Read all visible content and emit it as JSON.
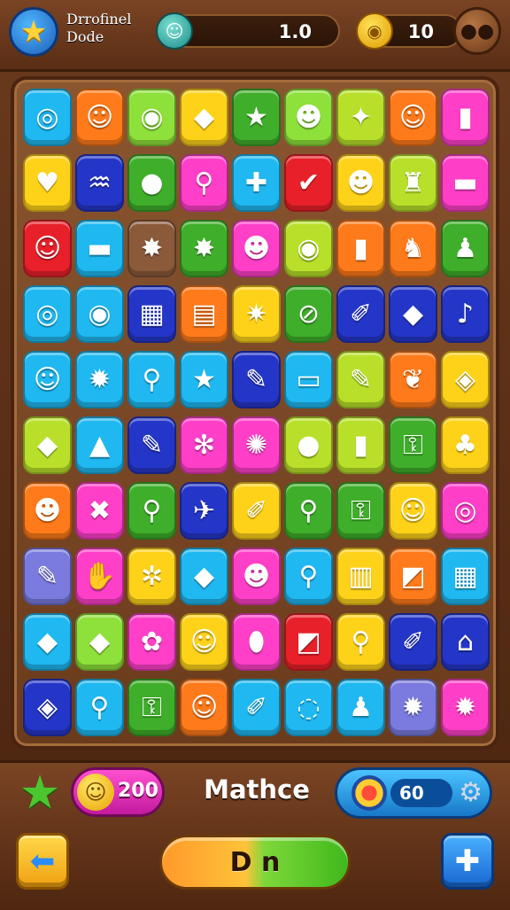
{
  "header": {
    "title": "Drrofinel\nDode",
    "level_value": "1.0",
    "coins_value": "10",
    "menu_glyph": "●●",
    "star_icon": "star-icon",
    "level_icon": "avatar-icon",
    "coin_icon": "coin-icon"
  },
  "board": {
    "rows": [
      [
        {
          "c": "#1fb8f0",
          "g": "◎"
        },
        {
          "c": "#ff7a1a",
          "g": "☺"
        },
        {
          "c": "#8ee03a",
          "g": "◉"
        },
        {
          "c": "#ffd21a",
          "g": "◆"
        },
        {
          "c": "#3fae2a",
          "g": "★"
        },
        {
          "c": "#8ee03a",
          "g": "☻"
        },
        {
          "c": "#b8e02a",
          "g": "✦"
        },
        {
          "c": "#ff7a1a",
          "g": "☺"
        },
        {
          "c": "#ff3fc8",
          "g": "▮"
        }
      ],
      [
        {
          "c": "#ffd21a",
          "g": "♥"
        },
        {
          "c": "#2436c8",
          "g": "♒"
        },
        {
          "c": "#3fae2a",
          "g": "●"
        },
        {
          "c": "#ff3fc8",
          "g": "⚲"
        },
        {
          "c": "#1fb8f0",
          "g": "✚"
        },
        {
          "c": "#e8202a",
          "g": "✔"
        },
        {
          "c": "#ffd21a",
          "g": "☻"
        },
        {
          "c": "#b8e02a",
          "g": "♜"
        },
        {
          "c": "#ff3fc8",
          "g": "▬"
        }
      ],
      [
        {
          "c": "#e8202a",
          "g": "☺"
        },
        {
          "c": "#1fb8f0",
          "g": "▬"
        },
        {
          "c": "#8a5a3a",
          "g": "✸"
        },
        {
          "c": "#3fae2a",
          "g": "✸"
        },
        {
          "c": "#ff3fc8",
          "g": "☻"
        },
        {
          "c": "#b8e02a",
          "g": "◉"
        },
        {
          "c": "#ff7a1a",
          "g": "▮"
        },
        {
          "c": "#ff7a1a",
          "g": "♞"
        },
        {
          "c": "#3fae2a",
          "g": "♟"
        }
      ],
      [
        {
          "c": "#1fb8f0",
          "g": "◎"
        },
        {
          "c": "#1fb8f0",
          "g": "◉"
        },
        {
          "c": "#2436c8",
          "g": "▦"
        },
        {
          "c": "#ff7a1a",
          "g": "▤"
        },
        {
          "c": "#ffd21a",
          "g": "✷"
        },
        {
          "c": "#3fae2a",
          "g": "⊘"
        },
        {
          "c": "#2436c8",
          "g": "✐"
        },
        {
          "c": "#2436c8",
          "g": "◆"
        },
        {
          "c": "#2436c8",
          "g": "♪"
        }
      ],
      [
        {
          "c": "#1fb8f0",
          "g": "☺"
        },
        {
          "c": "#1fb8f0",
          "g": "✹"
        },
        {
          "c": "#1fb8f0",
          "g": "⚲"
        },
        {
          "c": "#1fb8f0",
          "g": "★"
        },
        {
          "c": "#2436c8",
          "g": "✎"
        },
        {
          "c": "#1fb8f0",
          "g": "▭"
        },
        {
          "c": "#b8e02a",
          "g": "✎"
        },
        {
          "c": "#ff7a1a",
          "g": "❦"
        },
        {
          "c": "#ffd21a",
          "g": "◈"
        }
      ],
      [
        {
          "c": "#b8e02a",
          "g": "◆"
        },
        {
          "c": "#1fb8f0",
          "g": "▲"
        },
        {
          "c": "#2436c8",
          "g": "✎"
        },
        {
          "c": "#ff3fc8",
          "g": "✻"
        },
        {
          "c": "#ff3fc8",
          "g": "✺"
        },
        {
          "c": "#b8e02a",
          "g": "●"
        },
        {
          "c": "#b8e02a",
          "g": "▮"
        },
        {
          "c": "#3fae2a",
          "g": "⚿"
        },
        {
          "c": "#ffd21a",
          "g": "♣"
        }
      ],
      [
        {
          "c": "#ff7a1a",
          "g": "☻"
        },
        {
          "c": "#ff3fc8",
          "g": "✖"
        },
        {
          "c": "#3fae2a",
          "g": "⚲"
        },
        {
          "c": "#2436c8",
          "g": "✈"
        },
        {
          "c": "#ffd21a",
          "g": "✐"
        },
        {
          "c": "#3fae2a",
          "g": "⚲"
        },
        {
          "c": "#3fae2a",
          "g": "⚿"
        },
        {
          "c": "#ffd21a",
          "g": "☺"
        },
        {
          "c": "#ff3fc8",
          "g": "◎"
        }
      ],
      [
        {
          "c": "#7a7adf",
          "g": "✎"
        },
        {
          "c": "#ff3fc8",
          "g": "✋"
        },
        {
          "c": "#ffd21a",
          "g": "✲"
        },
        {
          "c": "#1fb8f0",
          "g": "◆"
        },
        {
          "c": "#ff3fc8",
          "g": "☻"
        },
        {
          "c": "#1fb8f0",
          "g": "⚲"
        },
        {
          "c": "#ffd21a",
          "g": "▥"
        },
        {
          "c": "#ff7a1a",
          "g": "◩"
        },
        {
          "c": "#1fb8f0",
          "g": "▦"
        }
      ],
      [
        {
          "c": "#1fb8f0",
          "g": "◆"
        },
        {
          "c": "#8ee03a",
          "g": "◆"
        },
        {
          "c": "#ff3fc8",
          "g": "✿"
        },
        {
          "c": "#ffd21a",
          "g": "☺"
        },
        {
          "c": "#ff3fc8",
          "g": "⬮"
        },
        {
          "c": "#e8202a",
          "g": "◩"
        },
        {
          "c": "#ffd21a",
          "g": "⚲"
        },
        {
          "c": "#2436c8",
          "g": "✐"
        },
        {
          "c": "#2436c8",
          "g": "⌂"
        }
      ],
      [
        {
          "c": "#2436c8",
          "g": "◈"
        },
        {
          "c": "#1fb8f0",
          "g": "⚲"
        },
        {
          "c": "#3fae2a",
          "g": "⚿"
        },
        {
          "c": "#ff7a1a",
          "g": "☺"
        },
        {
          "c": "#1fb8f0",
          "g": "✐"
        },
        {
          "c": "#1fb8f0",
          "g": "◌"
        },
        {
          "c": "#1fb8f0",
          "g": "♟"
        },
        {
          "c": "#7a7adf",
          "g": "✹"
        },
        {
          "c": "#ff3fc8",
          "g": "✹"
        }
      ]
    ]
  },
  "footer": {
    "score_value": "200",
    "matches_label": "Mathce",
    "moves_value": "60",
    "go_label": "D n",
    "back_glyph": "⬅",
    "plus_glyph": "✚",
    "gear_glyph": "⚙",
    "face_glyph": "☺",
    "green_star_glyph": "★"
  }
}
